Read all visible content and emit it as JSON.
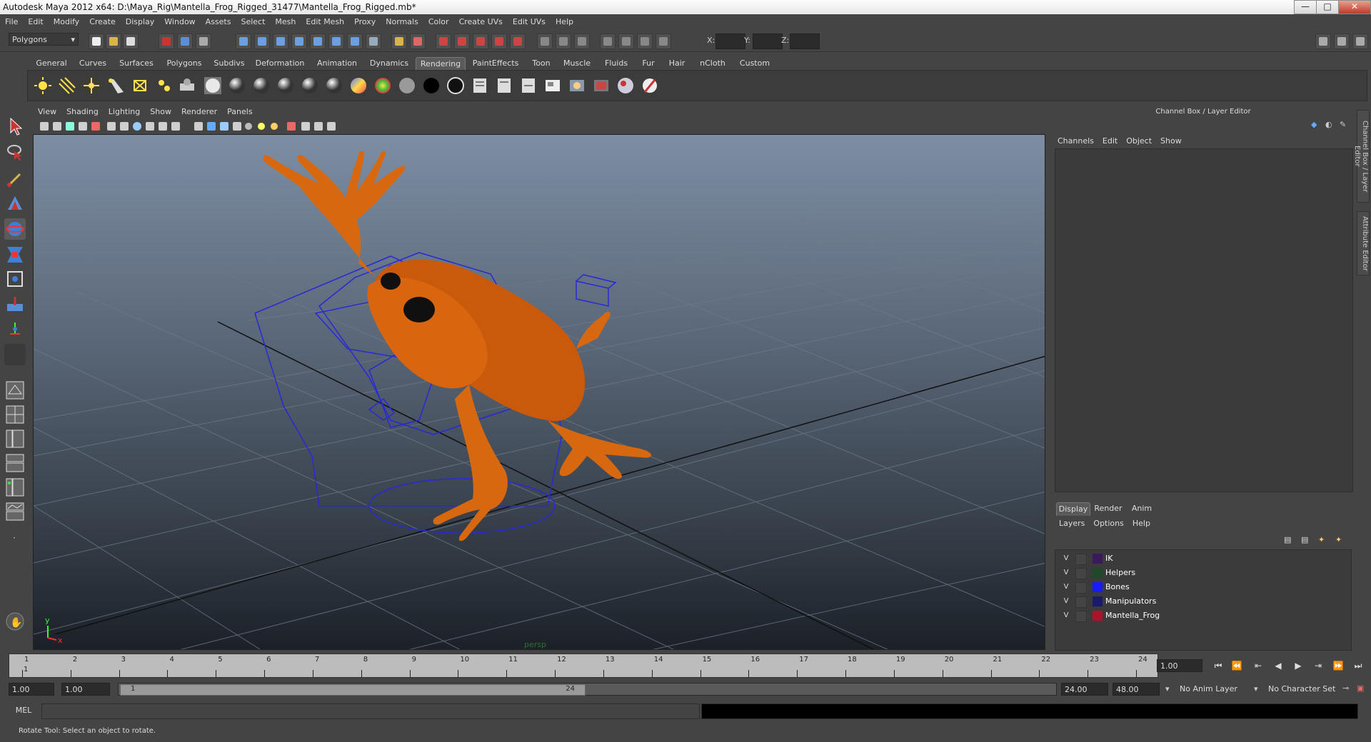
{
  "window": {
    "title": "Autodesk Maya 2012 x64: D:\\Maya_Rig\\Mantella_Frog_Rigged_31477\\Mantella_Frog_Rigged.mb*",
    "minimize": "—",
    "maximize": "□",
    "close": "✕"
  },
  "menubar": [
    "File",
    "Edit",
    "Modify",
    "Create",
    "Display",
    "Window",
    "Assets",
    "Select",
    "Mesh",
    "Edit Mesh",
    "Proxy",
    "Normals",
    "Color",
    "Create UVs",
    "Edit UVs",
    "Help"
  ],
  "statusline": {
    "mode": "Polygons",
    "x_label": "X:",
    "y_label": "Y:",
    "z_label": "Z:"
  },
  "shelf": {
    "tabs": [
      "General",
      "Curves",
      "Surfaces",
      "Polygons",
      "Subdivs",
      "Deformation",
      "Animation",
      "Dynamics",
      "Rendering",
      "PaintEffects",
      "Toon",
      "Muscle",
      "Fluids",
      "Fur",
      "Hair",
      "nCloth",
      "Custom"
    ],
    "active_tab": "Rendering"
  },
  "viewport": {
    "menu": [
      "View",
      "Shading",
      "Lighting",
      "Show",
      "Renderer",
      "Panels"
    ],
    "camera_label": "persp",
    "axis_x": "x",
    "axis_y": "y"
  },
  "channel_box": {
    "title": "Channel Box / Layer Editor",
    "menu": [
      "Channels",
      "Edit",
      "Object",
      "Show"
    ],
    "side_tabs": [
      "Channel Box / Layer Editor",
      "Attribute Editor"
    ]
  },
  "layer_editor": {
    "tabs": [
      "Display",
      "Render",
      "Anim"
    ],
    "active_tab": "Display",
    "menu": [
      "Layers",
      "Options",
      "Help"
    ],
    "layers": [
      {
        "visible": "V",
        "name": "IK",
        "color": "#3a1a5a"
      },
      {
        "visible": "V",
        "name": "Helpers",
        "color": "#1f4a2a"
      },
      {
        "visible": "V",
        "name": "Bones",
        "color": "#1a1aff"
      },
      {
        "visible": "V",
        "name": "Manipulators",
        "color": "#1a1a6a"
      },
      {
        "visible": "V",
        "name": "Mantella_Frog",
        "color": "#b0102a"
      }
    ]
  },
  "timeline": {
    "ticks": [
      "1",
      "2",
      "3",
      "4",
      "5",
      "6",
      "7",
      "8",
      "9",
      "10",
      "11",
      "12",
      "13",
      "14",
      "15",
      "16",
      "17",
      "18",
      "19",
      "20",
      "21",
      "22",
      "23",
      "24"
    ],
    "current_frame_marker": "1",
    "current_frame": "1.00"
  },
  "range": {
    "start_time": "1.00",
    "playback_start": "1.00",
    "range_start_label": "1",
    "range_end_label": "24",
    "playback_end": "24.00",
    "end_time": "48.00",
    "anim_layer": "No Anim Layer",
    "character_set": "No Character Set"
  },
  "command": {
    "label": "MEL"
  },
  "help_line": "Rotate Tool: Select an object to rotate."
}
